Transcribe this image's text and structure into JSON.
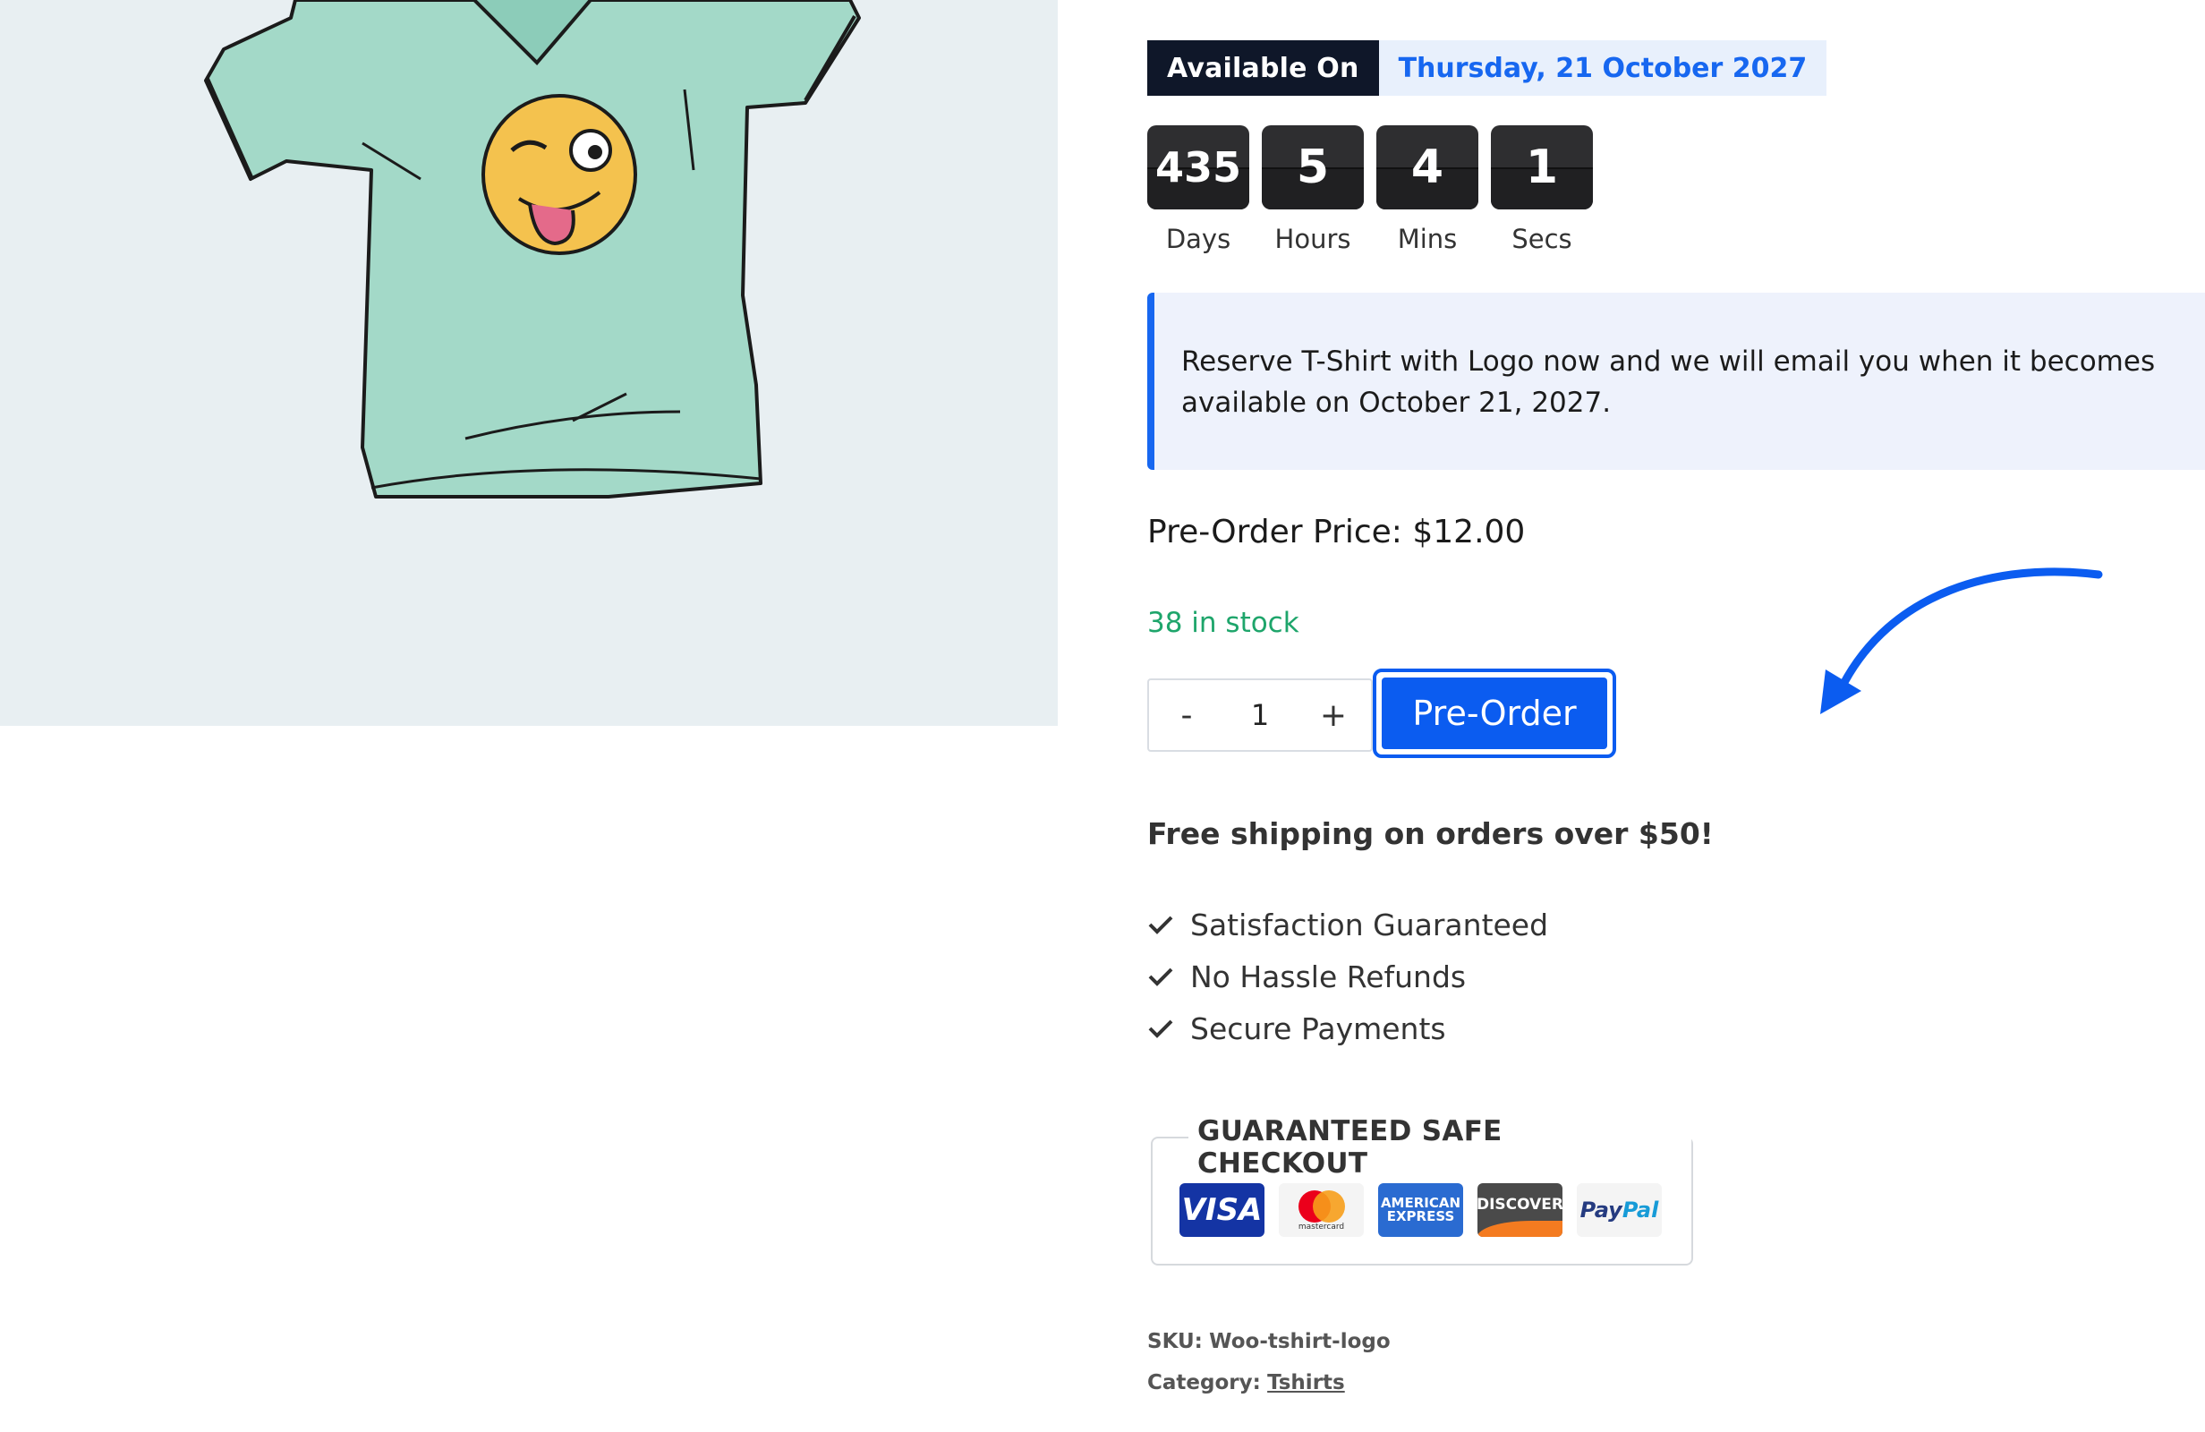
{
  "availability": {
    "label": "Available On",
    "date": "Thursday, 21 October 2027"
  },
  "countdown": [
    {
      "value": "435",
      "label": "Days"
    },
    {
      "value": "5",
      "label": "Hours"
    },
    {
      "value": "4",
      "label": "Mins"
    },
    {
      "value": "1",
      "label": "Secs"
    }
  ],
  "notice": "Reserve T-Shirt with Logo now and we will email you when it becomes available on October 21, 2027.",
  "price": "Pre-Order Price: $12.00",
  "stock": "38 in stock",
  "quantity": {
    "minus": "-",
    "value": "1",
    "plus": "+"
  },
  "preorder_button": "Pre-Order",
  "shipping": "Free shipping on orders over $50!",
  "features": [
    "Satisfaction Guaranteed",
    "No Hassle Refunds",
    "Secure Payments"
  ],
  "safe_checkout": {
    "title": "GUARANTEED SAFE CHECKOUT",
    "cards": {
      "visa": "VISA",
      "mastercard": "mastercard",
      "amex_line1": "AMERICAN",
      "amex_line2": "EXPRESS",
      "discover": "DISCOVER",
      "paypal_1": "Pay",
      "paypal_2": "Pal"
    }
  },
  "meta": {
    "sku_label": "SKU:",
    "sku": "Woo-tshirt-logo",
    "category_label": "Category:",
    "category": "Tshirts"
  },
  "colors": {
    "accent": "#1767f0",
    "stock_green": "#1ea56b",
    "badge_dark": "#0f1729",
    "notice_bg": "#eef2fc"
  }
}
